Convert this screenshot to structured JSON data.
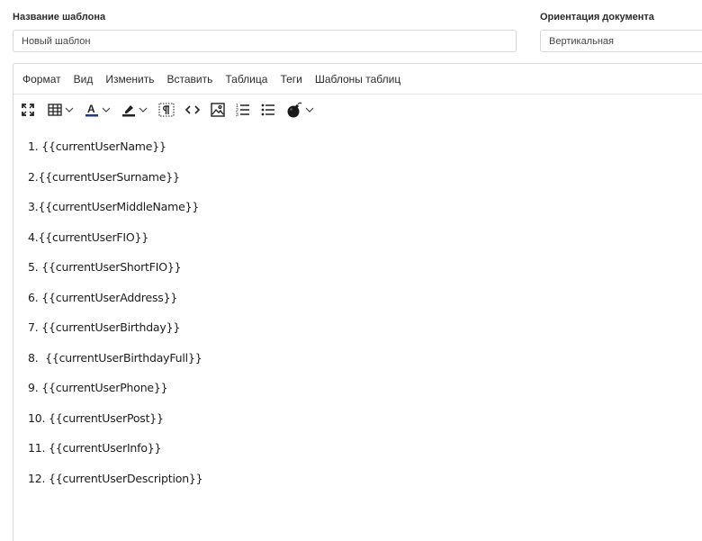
{
  "template_name": {
    "label": "Название шаблона",
    "value": "Новый шаблон"
  },
  "orientation": {
    "label": "Ориентация документа",
    "value": "Вертикальная"
  },
  "menu": [
    "Формат",
    "Вид",
    "Изменить",
    "Вставить",
    "Таблица",
    "Теги",
    "Шаблоны таблиц"
  ],
  "toolbar_icons": [
    "fullscreen-icon",
    "table-icon",
    "text-color-icon",
    "highlight-icon",
    "paragraph-marks-icon",
    "source-code-icon",
    "image-icon",
    "numbered-list-icon",
    "bullet-list-icon",
    "bomb-icon"
  ],
  "content_lines": [
    "1. {{currentUserName}}",
    "2.{{currentUserSurname}}",
    "3.{{currentUserMiddleName}}",
    "4.{{currentUserFIO}}",
    "5. {{currentUserShortFIO}}",
    "6. {{currentUserAddress}}",
    "7. {{currentUserBirthday}}",
    "8.  {{currentUserBirthdayFull}}",
    "9. {{currentUserPhone}}",
    "10. {{currentUserPost}}",
    "11. {{currentUserInfo}}",
    "12. {{currentUserDescription}}"
  ],
  "colors": {
    "border": "#d5d8dc",
    "text": "#222222",
    "text_color_bar": "#1f3a8a"
  }
}
